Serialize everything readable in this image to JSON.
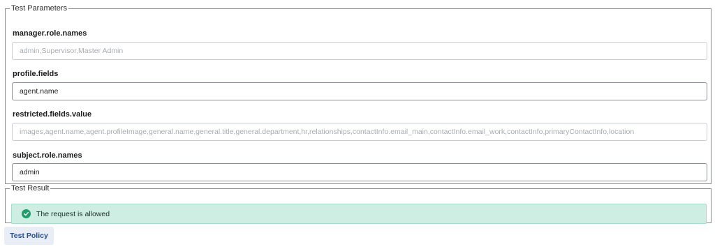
{
  "test_parameters": {
    "legend": "Test Parameters",
    "fields": [
      {
        "label": "manager.role.names",
        "value": "",
        "placeholder": "admin,Supervisor,Master Admin"
      },
      {
        "label": "profile.fields",
        "value": "agent.name",
        "placeholder": ""
      },
      {
        "label": "restricted.fields.value",
        "value": "",
        "placeholder": "images,agent.name,agent.profileImage,general.name,general.title,general.department,hr,relationships,contactInfo.email_main,contactInfo.email_work,contactInfo,primaryContactInfo,location"
      },
      {
        "label": "subject.role.names",
        "value": "admin",
        "placeholder": ""
      }
    ]
  },
  "test_result": {
    "legend": "Test Result",
    "status_icon": "check-circle-icon",
    "message": "The request is allowed",
    "colors": {
      "success_bg": "#cfeee3",
      "success_icon": "#1f9d6b"
    }
  },
  "actions": {
    "test_policy_label": "Test Policy"
  }
}
